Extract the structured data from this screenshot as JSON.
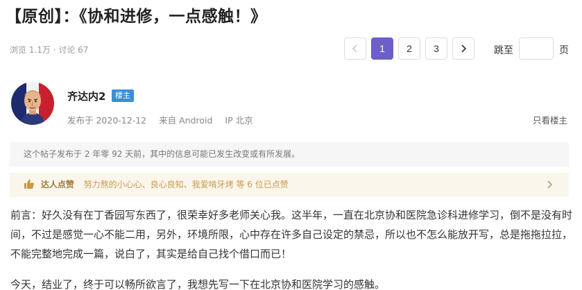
{
  "post": {
    "title": "【原创】：《协和进修，一点感触！》",
    "stats": "浏览 1.1万 · 讨论 67"
  },
  "pagination": {
    "pages": [
      "1",
      "2",
      "3"
    ],
    "active_page": "1",
    "jump_label": "跳至",
    "jump_value": "",
    "page_unit": "页"
  },
  "author": {
    "name": "齐达内2",
    "badge": "楼主",
    "posted": "发布于 2020-12-12",
    "source": "来自 Android",
    "ip": "IP 北京",
    "only_op": "只看楼主"
  },
  "notice": "这个帖子发布于 2 年零 92 天前，其中的信息可能已发生改变或有所发展。",
  "endorsement": {
    "label": "达人点赞",
    "names": "努力熬的小心心、良心良知、我爱啃牙烤 等 6 位已点赞"
  },
  "content": {
    "paragraph1": "前言：好久没有在丁香园写东西了，很荣幸好多老师关心我。这半年，一直在北京协和医院急诊科进修学习，倒不是没有时间，不过是感觉一心不能二用，另外，环境所限，心中存在许多自己设定的禁忌，所以也不怎么能放开写，总是拖拖拉拉，不能完整地完成一篇，说白了，其实是给自己找个借口而已！",
    "paragraph2": "今天，结业了，终于可以畅所欲言了，我想先写一下在北京协和医院学习的感触。"
  },
  "colors": {
    "accent": "#6c5fc7",
    "badge": "#3b8ed8",
    "endorse_bg": "#fbf6ec",
    "endorse_text": "#c89b4b"
  },
  "icons": {
    "prev": "chevron-left-icon",
    "next": "chevron-right-icon",
    "thumb": "thumbs-up-icon",
    "endorse_arrow": "chevron-right-icon"
  }
}
